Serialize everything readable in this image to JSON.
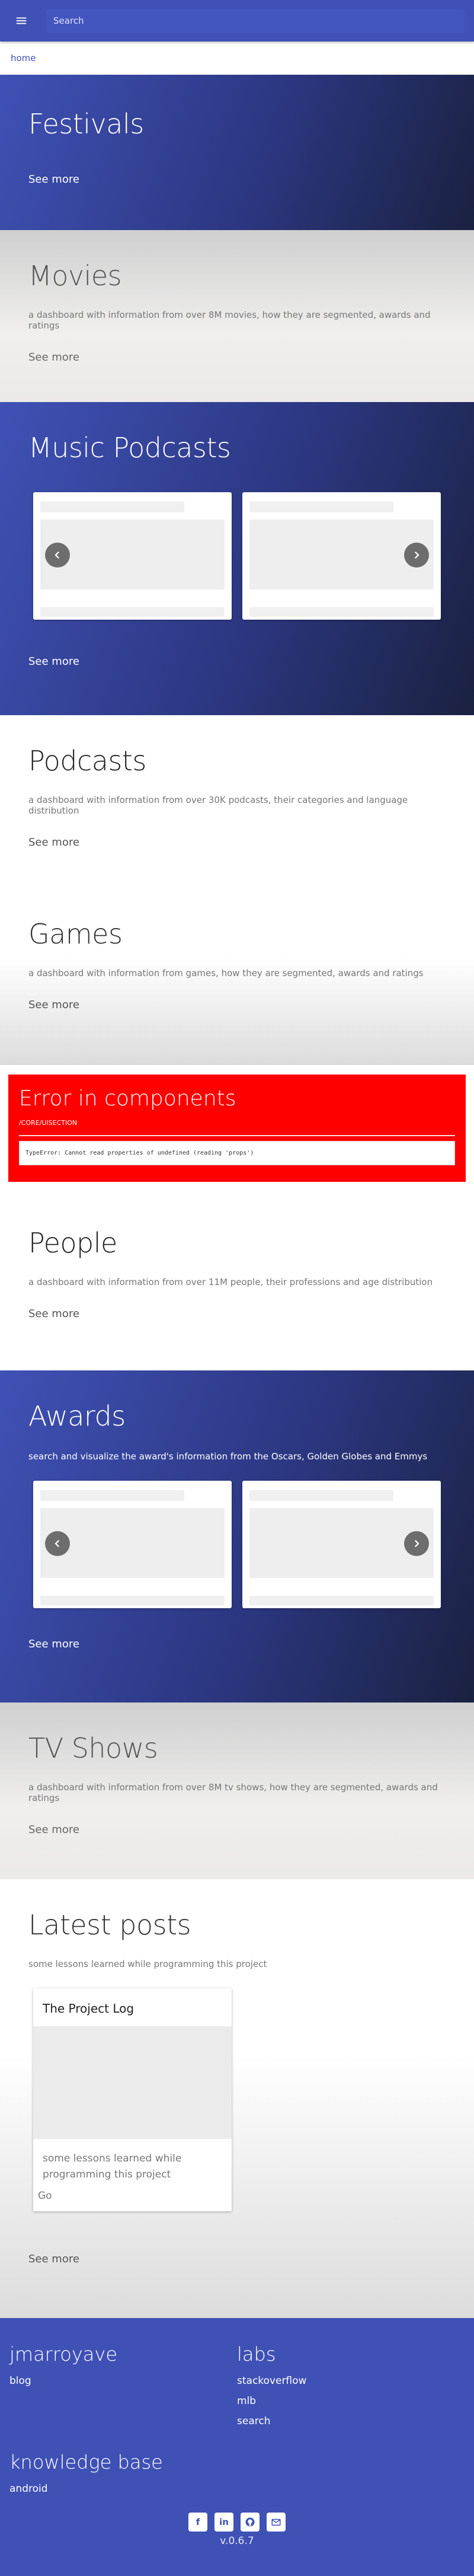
{
  "topbar": {
    "search_placeholder": "Search"
  },
  "breadcrumb": {
    "home": "home"
  },
  "sections": {
    "festivals": {
      "title": "Festivals",
      "see_more": "See more"
    },
    "movies": {
      "title": "Movies",
      "description": "a dashboard with information from over 8M movies, how they are segmented, awards and ratings",
      "see_more": "See more"
    },
    "music_podcasts": {
      "title": "Music Podcasts",
      "see_more": "See more"
    },
    "podcasts": {
      "title": "Podcasts",
      "description": "a dashboard with information from over 30K podcasts, their categories and language distribution",
      "see_more": "See more"
    },
    "games": {
      "title": "Games",
      "description": "a dashboard with information from games, how they are segmented, awards and ratings",
      "see_more": "See more"
    },
    "error": {
      "title": "Error in components",
      "path": "/CORE/UISECTION",
      "message": "TypeError: Cannot read properties of undefined (reading 'props')"
    },
    "people": {
      "title": "People",
      "description": "a dashboard with information from over 11M people, their professions and age distribution",
      "see_more": "See more"
    },
    "awards": {
      "title": "Awards",
      "description": "search and visualize the award's information from the Oscars, Golden Globes and Emmys",
      "see_more": "See more"
    },
    "tv_shows": {
      "title": "TV Shows",
      "description": "a dashboard with information from over 8M tv shows, how they are segmented, awards and ratings",
      "see_more": "See more"
    },
    "latest_posts": {
      "title": "Latest posts",
      "description": "some lessons learned while programming this project",
      "card": {
        "title": "The Project Log",
        "text": "some lessons learned while programming this project",
        "action": "Go"
      },
      "see_more": "See more"
    }
  },
  "footer": {
    "col1": {
      "title": "jmarroyave",
      "links": [
        "blog"
      ]
    },
    "col2": {
      "title": "labs",
      "links": [
        "stackoverflow",
        "mlb",
        "search"
      ]
    },
    "col3": {
      "title": "knowledge base",
      "links": [
        "android"
      ]
    },
    "version": "v.0.6.7",
    "socials": [
      "facebook-icon",
      "linkedin-icon",
      "github-icon",
      "email-icon"
    ]
  },
  "colors": {
    "primary": "#3f51b5",
    "error": "#ff0000"
  }
}
